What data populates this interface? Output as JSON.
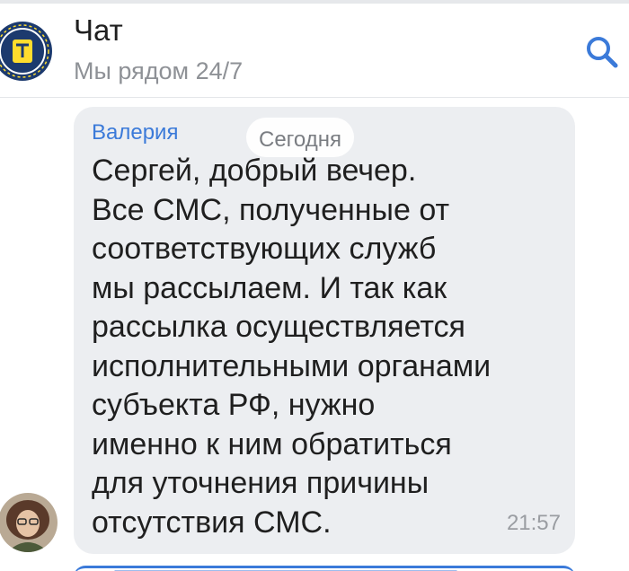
{
  "header": {
    "title": "Чат",
    "subtitle": "Мы рядом 24/7",
    "search_icon": "search-icon",
    "logo_icon": "bank-logo-icon"
  },
  "chat": {
    "date_chip": "Сегодня",
    "message": {
      "sender": "Валерия",
      "text": "Сергей, добрый вечер.\nВсе СМС, полученные от\nсоответствующих служб\nмы рассылаем. И так как\nрассылка осуществляется\nисполнительными органами\nсубъекта РФ, нужно\nименно к ним обратиться\nдля уточнения причины\nотсутствия СМС.",
      "time": "21:57"
    }
  },
  "colors": {
    "accent": "#3b7ad9",
    "bubble": "#eceef1",
    "logo_navy": "#1c3a6e",
    "logo_yellow": "#ffdd2d"
  }
}
